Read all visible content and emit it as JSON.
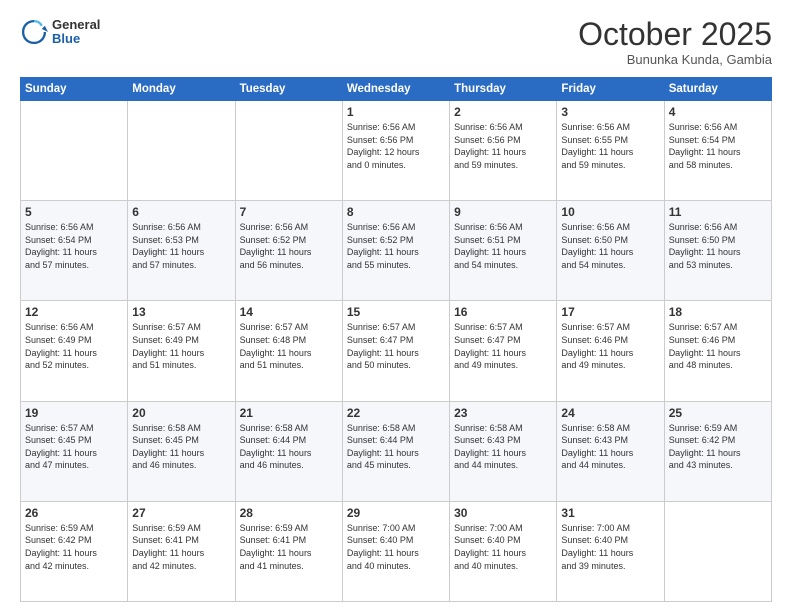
{
  "header": {
    "logo_general": "General",
    "logo_blue": "Blue",
    "month_title": "October 2025",
    "subtitle": "Bununka Kunda, Gambia"
  },
  "days_of_week": [
    "Sunday",
    "Monday",
    "Tuesday",
    "Wednesday",
    "Thursday",
    "Friday",
    "Saturday"
  ],
  "weeks": [
    [
      {
        "day": "",
        "info": ""
      },
      {
        "day": "",
        "info": ""
      },
      {
        "day": "",
        "info": ""
      },
      {
        "day": "1",
        "info": "Sunrise: 6:56 AM\nSunset: 6:56 PM\nDaylight: 12 hours\nand 0 minutes."
      },
      {
        "day": "2",
        "info": "Sunrise: 6:56 AM\nSunset: 6:56 PM\nDaylight: 11 hours\nand 59 minutes."
      },
      {
        "day": "3",
        "info": "Sunrise: 6:56 AM\nSunset: 6:55 PM\nDaylight: 11 hours\nand 59 minutes."
      },
      {
        "day": "4",
        "info": "Sunrise: 6:56 AM\nSunset: 6:54 PM\nDaylight: 11 hours\nand 58 minutes."
      }
    ],
    [
      {
        "day": "5",
        "info": "Sunrise: 6:56 AM\nSunset: 6:54 PM\nDaylight: 11 hours\nand 57 minutes."
      },
      {
        "day": "6",
        "info": "Sunrise: 6:56 AM\nSunset: 6:53 PM\nDaylight: 11 hours\nand 57 minutes."
      },
      {
        "day": "7",
        "info": "Sunrise: 6:56 AM\nSunset: 6:52 PM\nDaylight: 11 hours\nand 56 minutes."
      },
      {
        "day": "8",
        "info": "Sunrise: 6:56 AM\nSunset: 6:52 PM\nDaylight: 11 hours\nand 55 minutes."
      },
      {
        "day": "9",
        "info": "Sunrise: 6:56 AM\nSunset: 6:51 PM\nDaylight: 11 hours\nand 54 minutes."
      },
      {
        "day": "10",
        "info": "Sunrise: 6:56 AM\nSunset: 6:50 PM\nDaylight: 11 hours\nand 54 minutes."
      },
      {
        "day": "11",
        "info": "Sunrise: 6:56 AM\nSunset: 6:50 PM\nDaylight: 11 hours\nand 53 minutes."
      }
    ],
    [
      {
        "day": "12",
        "info": "Sunrise: 6:56 AM\nSunset: 6:49 PM\nDaylight: 11 hours\nand 52 minutes."
      },
      {
        "day": "13",
        "info": "Sunrise: 6:57 AM\nSunset: 6:49 PM\nDaylight: 11 hours\nand 51 minutes."
      },
      {
        "day": "14",
        "info": "Sunrise: 6:57 AM\nSunset: 6:48 PM\nDaylight: 11 hours\nand 51 minutes."
      },
      {
        "day": "15",
        "info": "Sunrise: 6:57 AM\nSunset: 6:47 PM\nDaylight: 11 hours\nand 50 minutes."
      },
      {
        "day": "16",
        "info": "Sunrise: 6:57 AM\nSunset: 6:47 PM\nDaylight: 11 hours\nand 49 minutes."
      },
      {
        "day": "17",
        "info": "Sunrise: 6:57 AM\nSunset: 6:46 PM\nDaylight: 11 hours\nand 49 minutes."
      },
      {
        "day": "18",
        "info": "Sunrise: 6:57 AM\nSunset: 6:46 PM\nDaylight: 11 hours\nand 48 minutes."
      }
    ],
    [
      {
        "day": "19",
        "info": "Sunrise: 6:57 AM\nSunset: 6:45 PM\nDaylight: 11 hours\nand 47 minutes."
      },
      {
        "day": "20",
        "info": "Sunrise: 6:58 AM\nSunset: 6:45 PM\nDaylight: 11 hours\nand 46 minutes."
      },
      {
        "day": "21",
        "info": "Sunrise: 6:58 AM\nSunset: 6:44 PM\nDaylight: 11 hours\nand 46 minutes."
      },
      {
        "day": "22",
        "info": "Sunrise: 6:58 AM\nSunset: 6:44 PM\nDaylight: 11 hours\nand 45 minutes."
      },
      {
        "day": "23",
        "info": "Sunrise: 6:58 AM\nSunset: 6:43 PM\nDaylight: 11 hours\nand 44 minutes."
      },
      {
        "day": "24",
        "info": "Sunrise: 6:58 AM\nSunset: 6:43 PM\nDaylight: 11 hours\nand 44 minutes."
      },
      {
        "day": "25",
        "info": "Sunrise: 6:59 AM\nSunset: 6:42 PM\nDaylight: 11 hours\nand 43 minutes."
      }
    ],
    [
      {
        "day": "26",
        "info": "Sunrise: 6:59 AM\nSunset: 6:42 PM\nDaylight: 11 hours\nand 42 minutes."
      },
      {
        "day": "27",
        "info": "Sunrise: 6:59 AM\nSunset: 6:41 PM\nDaylight: 11 hours\nand 42 minutes."
      },
      {
        "day": "28",
        "info": "Sunrise: 6:59 AM\nSunset: 6:41 PM\nDaylight: 11 hours\nand 41 minutes."
      },
      {
        "day": "29",
        "info": "Sunrise: 7:00 AM\nSunset: 6:40 PM\nDaylight: 11 hours\nand 40 minutes."
      },
      {
        "day": "30",
        "info": "Sunrise: 7:00 AM\nSunset: 6:40 PM\nDaylight: 11 hours\nand 40 minutes."
      },
      {
        "day": "31",
        "info": "Sunrise: 7:00 AM\nSunset: 6:40 PM\nDaylight: 11 hours\nand 39 minutes."
      },
      {
        "day": "",
        "info": ""
      }
    ]
  ]
}
